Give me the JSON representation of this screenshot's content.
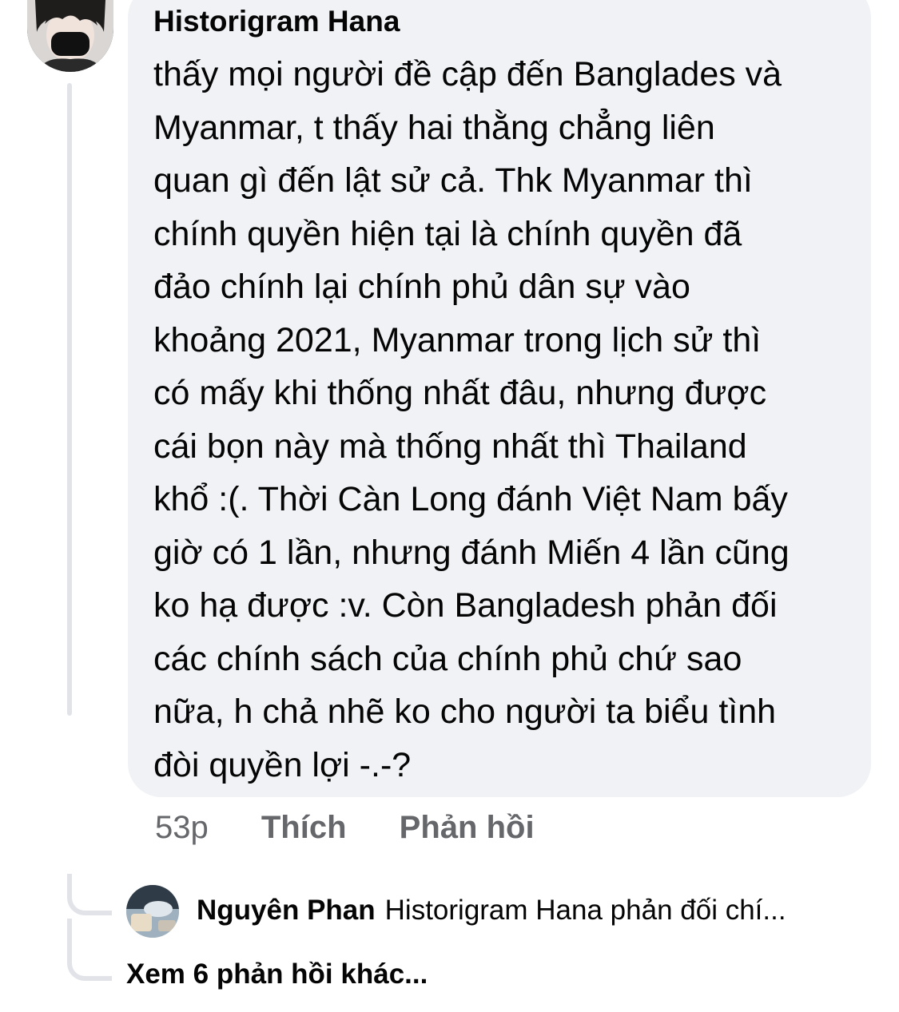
{
  "comment": {
    "author": "Historigram Hana",
    "lines": [
      "thấy mọi người đề cập đến Banglades và",
      "Myanmar, t thấy hai thằng chẳng liên",
      "quan gì đến lật sử cả. Thk Myanmar thì",
      "chính quyền hiện tại là chính quyền đã",
      "đảo chính lại chính phủ dân sự vào",
      "khoảng 2021, Myanmar trong lịch sử thì",
      "có mấy khi thống nhất đâu, nhưng được",
      "cái bọn này mà thống nhất thì Thailand",
      "khổ :(. Thời Càn Long đánh Việt Nam bấy",
      "giờ có 1 lần, nhưng đánh Miến 4 lần cũng",
      "ko hạ được :v. Còn Bangladesh phản đối",
      "các chính sách của chính phủ chứ sao",
      "nữa, h chả nhẽ ko cho người ta biểu tình",
      "đòi quyền lợi -.-?"
    ],
    "time": "53p",
    "like_label": "Thích",
    "reply_label": "Phản hồi"
  },
  "reply": {
    "author": "Nguyên Phan",
    "preview": "Historigram Hana  phản đối chí..."
  },
  "more_replies_label": "Xem 6 phản hồi khác...",
  "colors": {
    "bubble": "#f0f2f5",
    "text": "#050505",
    "secondary": "#65676b",
    "thread_line": "#e1e3e8"
  },
  "icons": {
    "main_avatar": "profile-photo",
    "reply_avatar": "profile-photo"
  }
}
